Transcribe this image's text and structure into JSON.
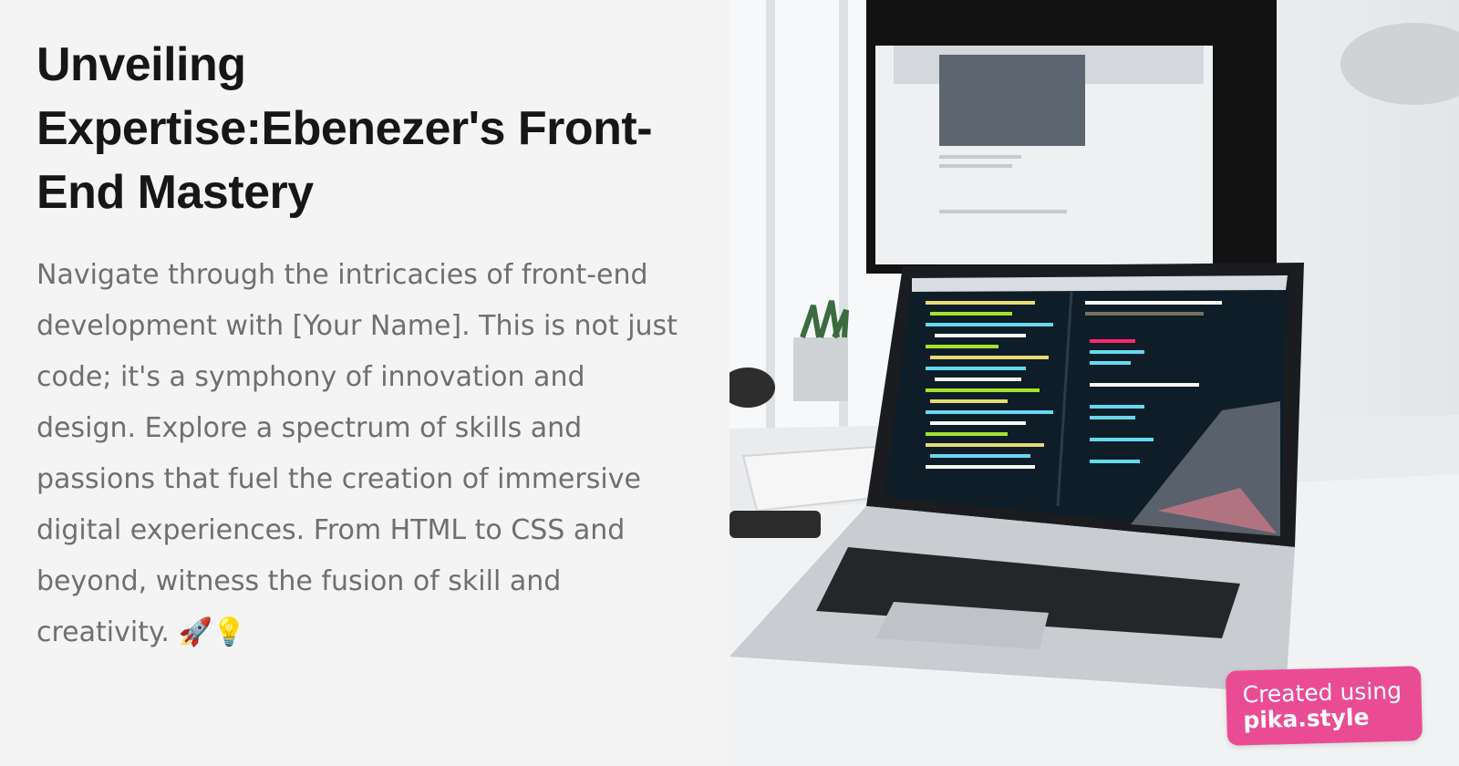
{
  "article": {
    "title": "Unveiling Expertise:Ebenezer's Front-End Mastery",
    "body": "Navigate through the intricacies of front-end development with [Your Name]. This is not just code; it's a symphony of innovation and design. Explore a spectrum of skills and passions that fuel the creation of immersive digital experiences. From HTML to CSS and beyond, witness the fusion of skill and creativity. 🚀💡"
  },
  "photo": {
    "icon": "laptop-desk-photo"
  },
  "badge": {
    "line1": "Created using",
    "line2": "pika.style",
    "color": "#ea4c94"
  },
  "colors": {
    "background": "#f4f4f4",
    "title": "#161616",
    "body": "#6f6f6f"
  }
}
